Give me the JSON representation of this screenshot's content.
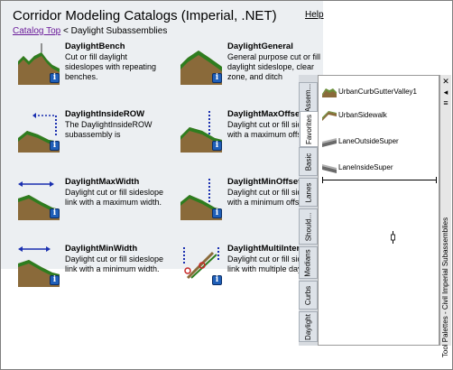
{
  "catalog": {
    "title": "Corridor Modeling Catalogs (Imperial, .NET)",
    "help": "Help",
    "breadcrumb": {
      "link": "Catalog Top",
      "rest": " < Daylight Subassemblies"
    },
    "entries": [
      {
        "title": "DaylightBench",
        "desc": "Cut or fill daylight sideslopes with repeating benches."
      },
      {
        "title": "DaylightGeneral",
        "desc": "General purpose cut or fill daylight sideslope, clear zone, and ditch"
      },
      {
        "title": "DaylightInsideROW",
        "desc": "The DaylightInsideROW subassembly is"
      },
      {
        "title": "DaylightMaxOffset",
        "desc": "Daylight cut or fill sideslope with a maximum offset."
      },
      {
        "title": "DaylightMaxWidth",
        "desc": "Daylight cut or fill sideslope link with a maximum width."
      },
      {
        "title": "DaylightMinOffset",
        "desc": "Daylight cut or fill sideslope with a minimum offset."
      },
      {
        "title": "DaylightMinWidth",
        "desc": "Daylight cut or fill sideslope link with a minimum width."
      },
      {
        "title": "DaylightMultiInterce",
        "desc": "Daylight cut or fill sideslope link with multiple daylight"
      }
    ]
  },
  "palette": {
    "title": "Tool Palettes - Civil Imperial Subassemblies",
    "tabs": [
      "Assem...",
      "Favorites",
      "Basic",
      "Lanes",
      "Should...",
      "Medians",
      "Curbs",
      "Daylight"
    ],
    "items": [
      "UrbanCurbGutterValley1",
      "UrbanSidewalk",
      "LaneOutsideSuper",
      "LaneInsideSuper"
    ],
    "buttons": {
      "close": "✕",
      "autohide": "◂",
      "properties": "≡"
    }
  },
  "colors": {
    "link": "#6a1b9a",
    "info": "#1f5fb8",
    "grass": "#2e7d1f",
    "soil": "#8a6a3a"
  }
}
